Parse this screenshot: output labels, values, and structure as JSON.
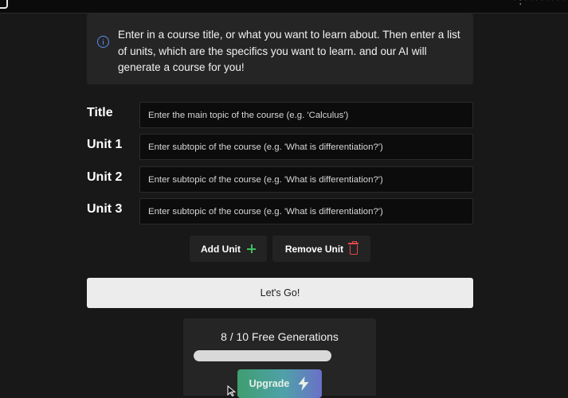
{
  "topbar": {
    "right_fragment": "' ; ' ' ' ' ' ' ' '"
  },
  "info": {
    "text": "Enter in a course title, or what you want to learn about. Then enter a list of units, which are the specifics you want to learn. and our AI will generate a course for you!",
    "icon": "info-icon",
    "accent": "#5b8df6"
  },
  "form": {
    "title": {
      "label": "Title",
      "placeholder": "Enter the main topic of the course (e.g. 'Calculus')",
      "value": ""
    },
    "units": [
      {
        "label": "Unit 1",
        "placeholder": "Enter subtopic of the course (e.g. 'What is differentiation?')",
        "value": ""
      },
      {
        "label": "Unit 2",
        "placeholder": "Enter subtopic of the course (e.g. 'What is differentiation?')",
        "value": ""
      },
      {
        "label": "Unit 3",
        "placeholder": "Enter subtopic of the course (e.g. 'What is differentiation?')",
        "value": ""
      }
    ]
  },
  "actions": {
    "add_unit_label": "Add Unit",
    "add_unit_icon": "plus-icon",
    "add_unit_color": "#3fbf5c",
    "remove_unit_label": "Remove Unit",
    "remove_unit_icon": "trash-icon",
    "remove_unit_color": "#e5484d",
    "go_label": "Let's Go!"
  },
  "generations": {
    "text": "8 / 10 Free Generations",
    "used": 8,
    "total": 10,
    "progress_fraction": 0.8,
    "upgrade_label": "Upgrade",
    "upgrade_icon": "lightning-bolt-icon"
  }
}
